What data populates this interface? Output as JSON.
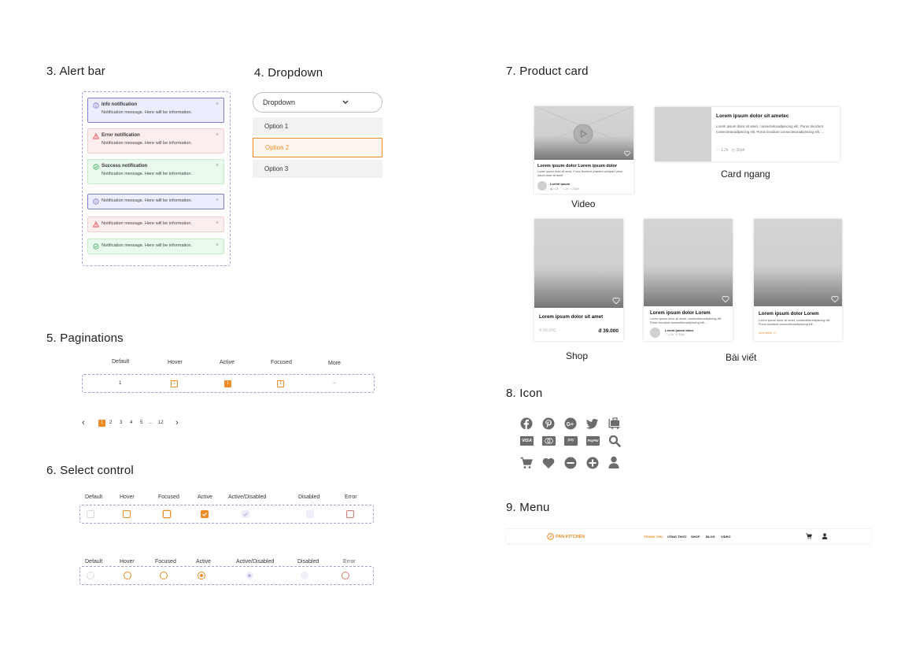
{
  "sections": {
    "alert_bar": "3. Alert bar",
    "dropdown": "4. Dropdown",
    "product_card": "7. Product card",
    "paginations": "5. Paginations",
    "select_control": "6. Select control",
    "icon": "8. Icon",
    "menu": "9. Menu"
  },
  "alerts": {
    "info_title": "Info notification",
    "error_title": "Error notification",
    "success_title": "Success notification",
    "message": "Notification message. Here will be information.",
    "close": "×"
  },
  "dropdown": {
    "label": "Dropdown",
    "options": [
      "Option 1",
      "Option 2",
      "Option 3"
    ]
  },
  "pagination": {
    "states": [
      "Default",
      "Hover",
      "Active",
      "Focused",
      "More"
    ],
    "values": [
      "1",
      "1",
      "1",
      "1",
      "..."
    ],
    "pager": [
      "1",
      "2",
      "3",
      "4",
      "5",
      "...",
      "12"
    ],
    "prev": "‹",
    "next": "›"
  },
  "select": {
    "states": [
      "Default",
      "Hover",
      "Focused",
      "Active",
      "Active/Disabled",
      "Disabled",
      "Error"
    ]
  },
  "cards": {
    "video_title": "Lorem ipsum dolor Lorem ipsum dolor",
    "video_desc": "Lorem ipsum dolor sit amet, Purus tincidunt pharetra volutpat Lorem ipsum dolor sit amet.",
    "video_author": "Lorem ipsum",
    "video_meta": [
      "1.2k",
      "1.2k",
      "30ph"
    ],
    "video_caption": "Video",
    "h_title": "Lorem ipsum dolor sit ametec",
    "h_desc": "Lorem ipsum dolor sit amet, consecteturadipiscing elit. Purus tincidunt consecteturadipiscing elit. Purus tincidunt consecteturadipiscing elit. ...",
    "h_meta": [
      "1.2k",
      "30ph"
    ],
    "h_caption": "Card ngang",
    "shop_title": "Lorem ipsum dolor sit amet",
    "shop_old_price": "đ 69.000",
    "shop_price": "đ 39.000",
    "shop_caption": "Shop",
    "blog_title": "Lorem ipsum dolor Lorem",
    "blog_desc": "Lorem ipsum dolor sit amet, consecteturadipiscing elit. Purus tincidunt consecteturadipiscing elit. ...",
    "blog_author": "Lorem ipsum dolor",
    "blog_meta": [
      "1.2k",
      "30ph"
    ],
    "blog_more": "Xem thêm >>",
    "blog_caption": "Bài viết"
  },
  "icons": {
    "row1": [
      "facebook-icon",
      "pinterest-icon",
      "google-plus-icon",
      "twitter-icon",
      "luggage-icon"
    ],
    "row2": [
      "visa-icon",
      "mastercard-icon",
      "amazon-pay-icon",
      "paypal-icon",
      "search-icon"
    ],
    "row3": [
      "cart-icon",
      "heart-icon",
      "minus-icon",
      "plus-icon",
      "user-icon"
    ],
    "visa": "VISA",
    "pay": "pay",
    "paypal": "PayPal"
  },
  "menu": {
    "brand": "PAN KITCHEN",
    "items": [
      "TRANG CHỦ",
      "CÔNG THỨC",
      "SHOP",
      "BLOG",
      "VIDEO"
    ]
  },
  "colors": {
    "accent": "#ee8b25",
    "info": "#7c7fd1",
    "error": "#e54848",
    "success": "#3aa85a",
    "dash": "#a79fd6"
  }
}
